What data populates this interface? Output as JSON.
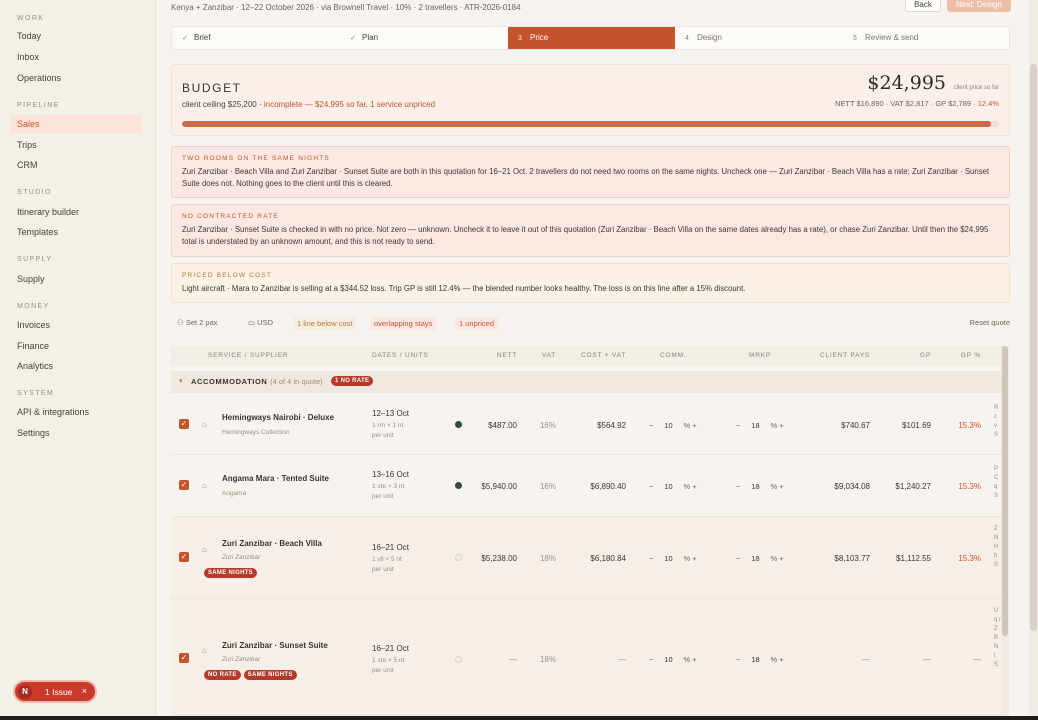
{
  "sidebar": {
    "sections": [
      {
        "title": "WORK",
        "items": [
          "Today",
          "Inbox",
          "Operations"
        ]
      },
      {
        "title": "PIPELINE",
        "items": [
          "Sales",
          "Trips",
          "CRM"
        ]
      },
      {
        "title": "STUDIO",
        "items": [
          "Itinerary builder",
          "Templates"
        ]
      },
      {
        "title": "SUPPLY",
        "items": [
          "Supply"
        ]
      },
      {
        "title": "MONEY",
        "items": [
          "Invoices",
          "Finance",
          "Analytics"
        ]
      },
      {
        "title": "SYSTEM",
        "items": [
          "API & integrations",
          "Settings"
        ]
      }
    ],
    "active": "Sales"
  },
  "header": {
    "breadcrumb": "Kenya + Zanzibar · 12–22 October 2026 · via Brownell Travel · 10% · 2 travellers · ATR-2026-0184",
    "back_label": "Back",
    "next_label": "Next: Design"
  },
  "steps": [
    {
      "num": "✓",
      "label": "Brief"
    },
    {
      "num": "✓",
      "label": "Plan"
    },
    {
      "num": "3",
      "label": "Price"
    },
    {
      "num": "4",
      "label": "Design"
    },
    {
      "num": "5",
      "label": "Review & send"
    }
  ],
  "budget": {
    "title": "BUDGET",
    "ceiling": "client ceiling $25,200 ·",
    "status": "incomplete — $24,995 so far, 1 service unpriced",
    "total": "$24,995",
    "total_label": "client price so far",
    "breakdown": "NETT $16,890 · VAT $2,817 · GP $2,789 ·",
    "gp_pct": "12.4%",
    "progress": 0.99
  },
  "alerts": [
    {
      "title": "TWO ROOMS ON THE SAME NIGHTS",
      "body": "Zuri Zanzibar · Beach Villa and Zuri Zanzibar · Sunset Suite are both in this quotation for 16–21 Oct. 2 travellers do not need two rooms on the same nights. Uncheck one — Zuri Zanzibar · Beach Villa has a rate; Zuri Zanzibar · Sunset Suite does not. Nothing goes to the client until this is cleared."
    },
    {
      "title": "NO CONTRACTED RATE",
      "body": "Zuri Zanzibar · Sunset Suite is checked in with no price. Not zero — unknown. Uncheck it to leave it out of this quotation (Zuri Zanzibar · Beach Villa on the same dates already has a rate), or chase Zuri Zanzibar. Until then the $24,995 total is understated by an unknown amount, and this is not ready to send."
    },
    {
      "title": "PRICED BELOW COST",
      "body": "Light aircraft · Mara to Zanzibar is selling at a $344.52 loss. Trip GP is still 12.4% — the blended number looks healthy. The loss is on this line after a 15% discount."
    }
  ],
  "filters": {
    "pax": "Set 2 pax",
    "currency": "USD",
    "below_cost": "1 line below cost",
    "overlapping": "overlapping stays",
    "unpriced": "1 unpriced",
    "reset": "Reset quote"
  },
  "table": {
    "headers": {
      "service": "SERVICE / SUPPLIER",
      "dates": "DATES / UNITS",
      "nett": "NETT",
      "vat": "VAT",
      "cost_vat": "COST + VAT",
      "comm": "COMM.",
      "mrkp": "MRKP",
      "client_pays": "CLIENT PAYS",
      "gp": "GP",
      "gp_pct": "GP %"
    },
    "group": {
      "name": "ACCOMMODATION",
      "count": "(4 of 4 in quote)",
      "tag": "1 NO RATE"
    },
    "rows": [
      {
        "name": "Hemingways Nairobi · Deluxe",
        "supplier": "Hemingways Collection",
        "dates": "12–13 Oct",
        "units1": "1 rm × 1 nt",
        "units2": "per unit",
        "nett": "$487.00",
        "vat": "16%",
        "cost_vat": "$564.92",
        "comm": "10",
        "mrkp": "18",
        "client_pays": "$740.67",
        "gp": "$101.69",
        "gp_pct": "15.3%",
        "cut": "R c v S",
        "tags": [],
        "rated": true
      },
      {
        "name": "Angama Mara · Tented Suite",
        "supplier": "Angama",
        "dates": "13–16 Oct",
        "units1": "1 ste × 3 nt",
        "units2": "per unit",
        "nett": "$5,940.00",
        "vat": "16%",
        "cost_vat": "$6,890.40",
        "comm": "10",
        "mrkp": "18",
        "client_pays": "$9,034.08",
        "gp": "$1,240.27",
        "gp_pct": "15.3%",
        "cut": "P C q S",
        "tags": [],
        "rated": true
      },
      {
        "name": "Zuri Zanzibar · Beach Villa",
        "supplier": "Zuri Zanzibar",
        "dates": "16–21 Oct",
        "units1": "1 vll × 5 nt",
        "units2": "per unit",
        "nett": "$5,238.00",
        "vat": "18%",
        "cost_vat": "$6,180.84",
        "comm": "10",
        "mrkp": "18",
        "client_pays": "$8,103.77",
        "gp": "$1,112.55",
        "gp_pct": "15.3%",
        "cut": "Z N H b S",
        "tags": [
          "SAME NIGHTS"
        ],
        "rated": false
      },
      {
        "name": "Zuri Zanzibar · Sunset Suite",
        "supplier": "Zuri Zanzibar",
        "dates": "16–21 Oct",
        "units1": "1 ste × 5 nt",
        "units2": "per unit",
        "nett": "—",
        "vat": "18%",
        "cost_vat": "—",
        "comm": "10",
        "mrkp": "18",
        "client_pays": "—",
        "gp": "—",
        "gp_pct": "—",
        "cut": "U q r Z B N t S",
        "tags": [
          "NO RATE",
          "SAME NIGHTS"
        ],
        "rated": false
      }
    ]
  },
  "issue_badge": {
    "letter": "N",
    "label": "1 Issue",
    "close": "×"
  },
  "colors": {
    "accent": "#c5542d",
    "alert_red_bg": "#fbe8e2",
    "alert_amber_bg": "#fbf1e4",
    "tag_red": "#b63a2a",
    "rate_dot": "#2e4a42"
  }
}
